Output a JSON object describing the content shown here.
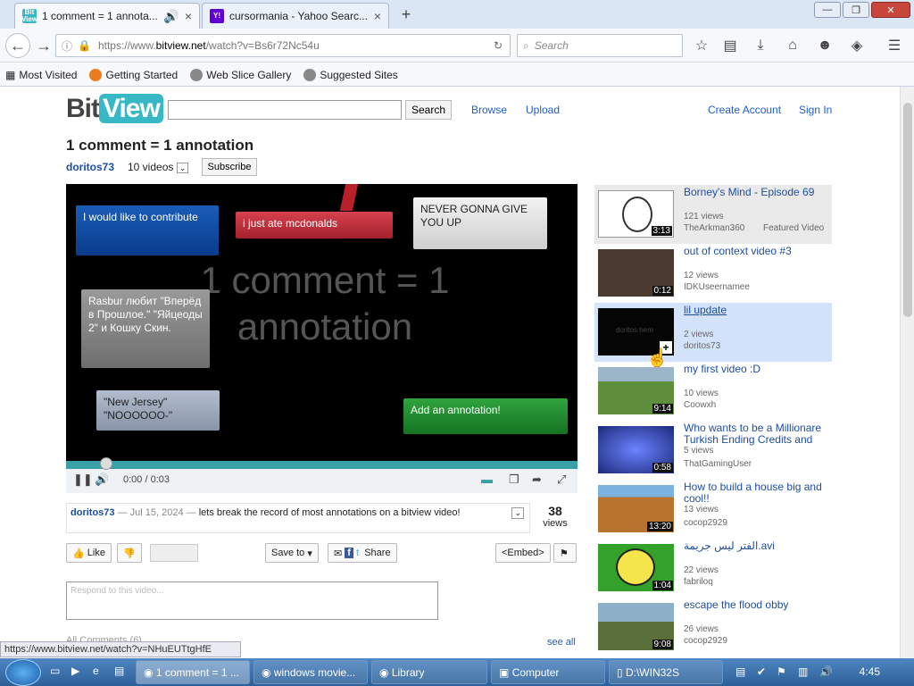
{
  "browser": {
    "tabs": [
      {
        "title": "1 comment = 1 annota...",
        "favicon": "BitView",
        "active": true
      },
      {
        "title": "cursormania - Yahoo Searc...",
        "favicon": "Y!",
        "active": false
      }
    ],
    "url_prefix": "https://www.",
    "url_host": "bitview.net",
    "url_path": "/watch?v=Bs6r72Nc54u",
    "search_placeholder": "Search",
    "bookmarks": [
      "Most Visited",
      "Getting Started",
      "Web Slice Gallery",
      "Suggested Sites"
    ],
    "status_url": "https://www.bitview.net/watch?v=NHuEUTtgHfE"
  },
  "site": {
    "logo_a": "Bit",
    "logo_b": "View",
    "search_button": "Search",
    "nav": [
      "Browse",
      "Upload"
    ],
    "account": [
      "Create Account",
      "Sign In"
    ]
  },
  "video": {
    "title": "1 comment = 1 annotation",
    "author": "doritos73",
    "video_count": "10 videos",
    "subscribe": "Subscribe",
    "frame_text": "1 comment = 1 annotation",
    "annotations": [
      {
        "text": "I would like to contribute",
        "color": "#0a3c8c"
      },
      {
        "text": "i just ate mcdonalds",
        "color": "#b52a36"
      },
      {
        "text": "NEVER GONNA GIVE YOU UP",
        "color": "#d9d9d9"
      },
      {
        "text": "Rasbur любит \"Вперёд в Прошлое.\" \"Яйцеоды 2\" и Кошку Скин.",
        "color": "#7a7a7a"
      },
      {
        "text": "\"New Jersey\" \"NOOOOOO-\"",
        "color": "#9aa6b8"
      },
      {
        "text": "Add an annotation!",
        "color": "#1e8a2e"
      }
    ],
    "time": "0:00 / 0:03",
    "progress": 0.0,
    "comment_author": "doritos73",
    "comment_date": "— Jul 15, 2024 —",
    "comment_text": "lets break the record of most annotations on a bitview video!",
    "views_count": "38",
    "views_label": "views",
    "like": "Like",
    "save_to": "Save to",
    "share": "Share",
    "embed": "<Embed>",
    "respond_placeholder": "Respond to this video...",
    "all_comments": "All Comments (6)",
    "see_all": "see all"
  },
  "related": [
    {
      "title": "Borney's Mind - Episode 69",
      "views": "121 views",
      "user": "TheArkman360",
      "extra": "Featured Video",
      "duration": "3:13",
      "thumb": "#ffffff"
    },
    {
      "title": "out of context video #3",
      "views": "12 views",
      "user": "IDKUseernamee",
      "duration": "0:12",
      "thumb": "#4a3a30"
    },
    {
      "title": "lil update",
      "views": "2 views",
      "user": "doritos73",
      "duration": "",
      "thumb": "#050505",
      "thumb_text": "doritos here"
    },
    {
      "title": "my first video :D",
      "views": "10 views",
      "user": "Coowxh",
      "duration": "9:14",
      "thumb": "#5f8f3c"
    },
    {
      "title": "Who wants to be a Millionare Turkish Ending Credits and",
      "views": "5 views",
      "user": "ThatGamingUser",
      "duration": "0:58",
      "thumb": "#1c2a7a"
    },
    {
      "title": "How to build a house big and cool!!",
      "views": "13 views",
      "user": "cocop2929",
      "duration": "13:20",
      "thumb": "#b8742e"
    },
    {
      "title": "الفتر ليس جريمة.avi",
      "views": "22 views",
      "user": "fabriloq",
      "duration": "1:04",
      "thumb": "#33a12a"
    },
    {
      "title": "escape the flood obby",
      "views": "26 views",
      "user": "cocop2929",
      "duration": "9:08",
      "thumb": "#8cb0c8"
    }
  ],
  "taskbar": {
    "items": [
      "1 comment = 1 ...",
      "windows movie...",
      "Library",
      "Computer",
      "D:\\WIN32S"
    ],
    "clock": "4:45"
  }
}
